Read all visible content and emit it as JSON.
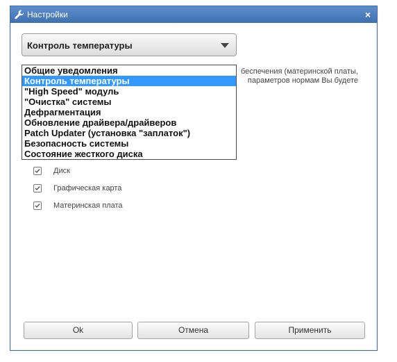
{
  "window": {
    "title": "Настройки",
    "close_label": "×"
  },
  "select": {
    "value": "Контроль температуры"
  },
  "description": {
    "line1": "беспечения (материнской платы,",
    "line2": "параметров нормам Вы будете"
  },
  "dropdown": {
    "options": [
      "Общие уведомления",
      "Контроль температуры",
      "\"High Speed\" модуль",
      "\"Очистка\" системы",
      "Дефрагментация",
      "Обновление драйвера/драйверов",
      "Patch Updater (установка \"заплаток\")",
      "Безопасность системы",
      "Состояние жесткого диска"
    ],
    "selected_index": 1
  },
  "checks": [
    {
      "label": "Диск",
      "checked": true
    },
    {
      "label": "Графическая карта",
      "checked": true
    },
    {
      "label": "Материнская плата",
      "checked": true
    }
  ],
  "buttons": {
    "ok": "Ok",
    "cancel": "Отмена",
    "apply": "Применить"
  }
}
